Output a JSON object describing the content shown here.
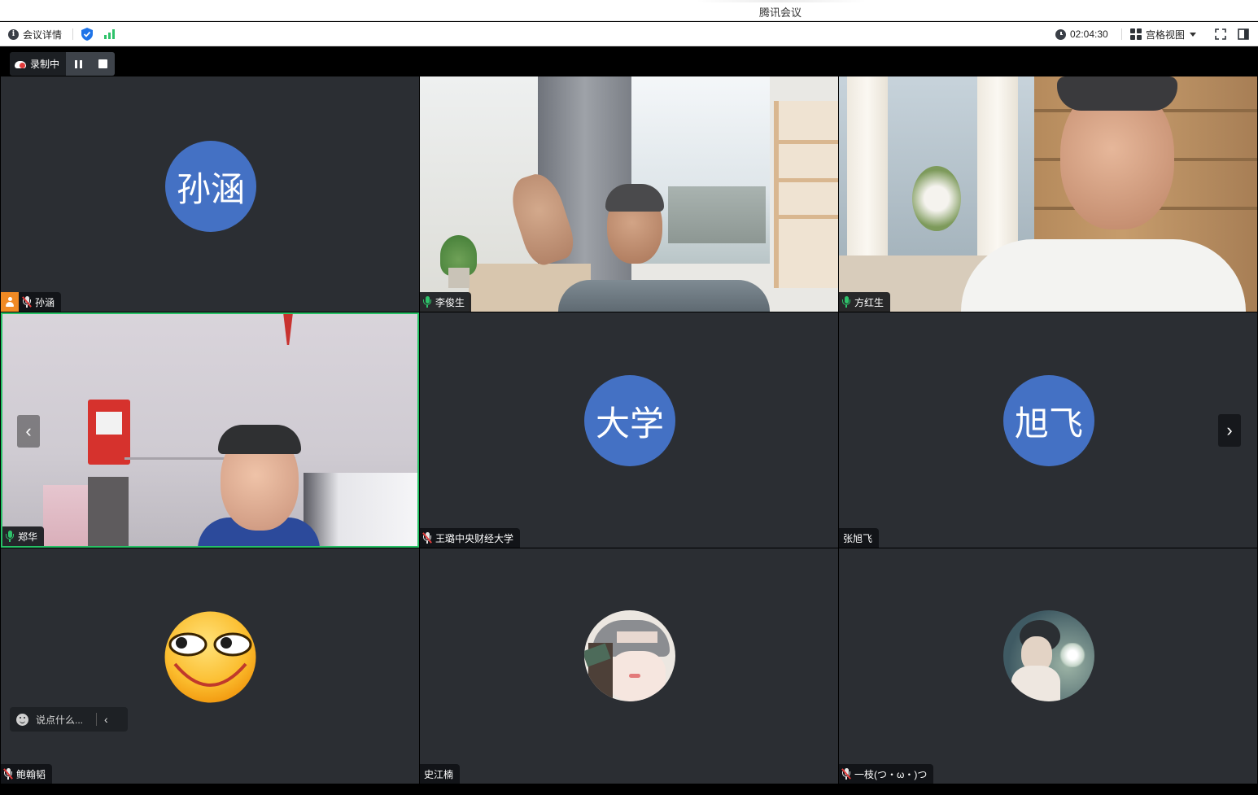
{
  "window": {
    "title": "腾讯会议"
  },
  "toolbar": {
    "meeting_info_label": "会议详情",
    "duration": "02:04:30",
    "view_label": "宫格视图"
  },
  "recording": {
    "status_label": "录制中"
  },
  "chat": {
    "placeholder": "说点什么..."
  },
  "participants": [
    {
      "name": "孙涵",
      "avatar_text": "孙涵",
      "video": false,
      "mic": "muted",
      "host": true
    },
    {
      "name": "李俊生",
      "video": true,
      "mic": "on"
    },
    {
      "name": "方红生",
      "video": true,
      "mic": "on"
    },
    {
      "name": "郑华",
      "video": true,
      "mic": "on",
      "speaking": true
    },
    {
      "name": "王璐中央财经大学",
      "avatar_text": "大学",
      "video": false,
      "mic": "muted"
    },
    {
      "name": "张旭飞",
      "avatar_text": "旭飞",
      "video": false,
      "mic": "none"
    },
    {
      "name": "鲍翰韬",
      "avatar": "smiley-emoji",
      "video": false,
      "mic": "muted"
    },
    {
      "name": "史江楠",
      "avatar": "illustrated-girl-photo",
      "video": false,
      "mic": "none"
    },
    {
      "name": "一枝(つ・ω・)つ",
      "avatar": "painting-photo",
      "video": false,
      "mic": "muted"
    }
  ]
}
